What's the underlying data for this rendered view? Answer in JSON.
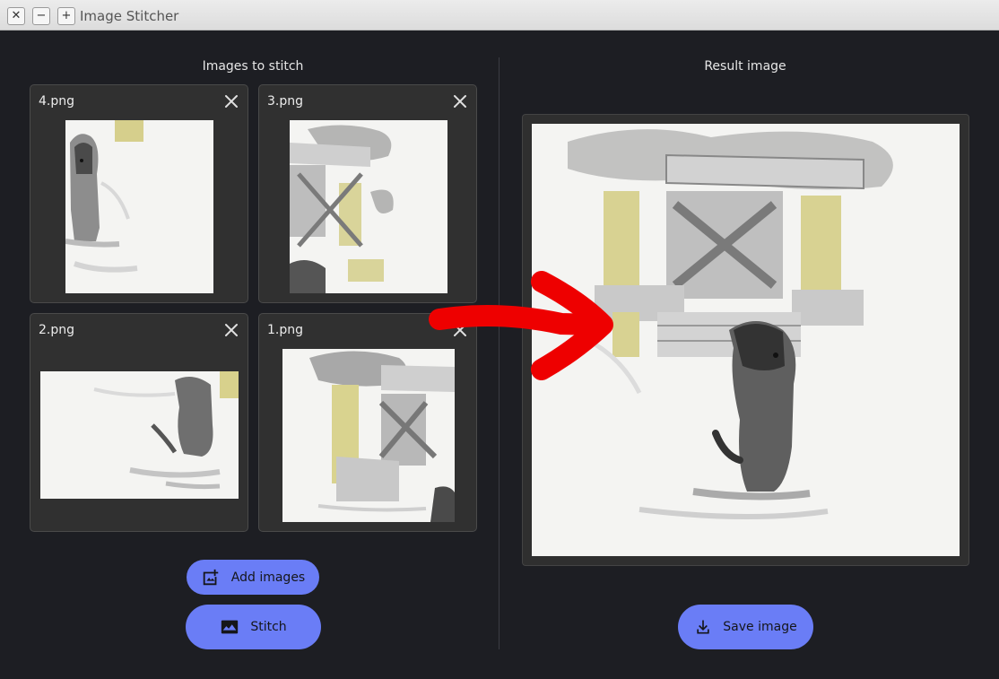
{
  "window": {
    "title": "Image Stitcher",
    "controls": {
      "close": "✕",
      "minimize": "−",
      "maximize": "+"
    }
  },
  "left": {
    "title": "Images to stitch",
    "images": [
      {
        "name": "4.png"
      },
      {
        "name": "3.png"
      },
      {
        "name": "2.png"
      },
      {
        "name": "1.png"
      }
    ],
    "add_button": "Add images",
    "stitch_button": "Stitch"
  },
  "right": {
    "title": "Result image",
    "save_button": "Save image"
  },
  "colors": {
    "accent": "#6a7df6",
    "background": "#1d1e23",
    "card": "#303030",
    "arrow": "#ee0000"
  }
}
